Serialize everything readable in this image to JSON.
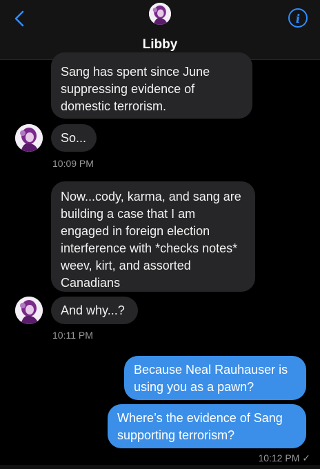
{
  "header": {
    "contact_name": "Libby",
    "back_icon": "chevron-left-icon",
    "info_icon": "info-icon",
    "accent_color": "#2f8cff"
  },
  "messages": [
    {
      "sender": "Libby",
      "text": "Sang has spent since June suppressing evidence of domestic terrorism."
    },
    {
      "sender": "Libby",
      "text": "So..."
    },
    {
      "sender": "Libby",
      "text": "Now...cody, karma, and sang are building a case that I am engaged in foreign election interference with *checks notes* weev, kirt, and assorted Canadians"
    },
    {
      "sender": "Libby",
      "text": "And why...?"
    },
    {
      "sender": "me",
      "text": "Because Neal Rauhauser is using you as a pawn?"
    },
    {
      "sender": "me",
      "text": "Where’s the evidence of Sang supporting terrorism?"
    }
  ],
  "timestamps": {
    "t1": "10:09 PM",
    "t2": "10:11 PM",
    "t3": "10:12 PM"
  },
  "read_receipt": "✓",
  "colors": {
    "incoming_bubble": "#262628",
    "outgoing_bubble": "#3b8fe8",
    "background": "#000000"
  }
}
